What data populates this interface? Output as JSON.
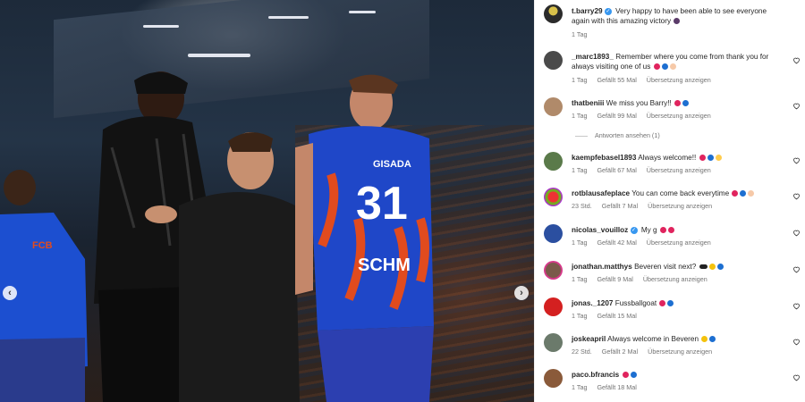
{
  "post": {
    "author": "t.barry29",
    "caption": "Very happy to have been able to see everyone again with this amazing victory",
    "time": "1 Tag"
  },
  "photo": {
    "jersey_name": "GISADA",
    "jersey_number": "31",
    "back_text": "SCHM",
    "crest_text": "FCB"
  },
  "comments": [
    {
      "user": "_marc1893_",
      "text": "Remember where you come from thank you for always visiting one of us",
      "time": "1 Tag",
      "likes": "Gefällt 55 Mal",
      "translate": "Übersetzung anzeigen"
    },
    {
      "user": "thatbeniii",
      "text": "We miss you Barry!!",
      "time": "1 Tag",
      "likes": "Gefällt 99 Mal",
      "translate": "Übersetzung anzeigen",
      "replies": "Antworten ansehen (1)"
    },
    {
      "user": "kaempfebasel1893",
      "text": "Always welcome!!",
      "time": "1 Tag",
      "likes": "Gefällt 67 Mal",
      "translate": "Übersetzung anzeigen"
    },
    {
      "user": "rotblausafeplace",
      "text": "You can come back everytime",
      "time": "23 Std.",
      "likes": "Gefällt 7 Mal",
      "translate": "Übersetzung anzeigen"
    },
    {
      "user": "nicolas_vouilloz",
      "text": "My g",
      "time": "1 Tag",
      "likes": "Gefällt 42 Mal",
      "translate": "Übersetzung anzeigen"
    },
    {
      "user": "jonathan.matthys",
      "text": "Beveren visit next?",
      "time": "1 Tag",
      "likes": "Gefällt 9 Mal",
      "translate": "Übersetzung anzeigen"
    },
    {
      "user": "jonas._1207",
      "text": "Fussballgoat",
      "time": "1 Tag",
      "likes": "Gefällt 15 Mal",
      "translate": ""
    },
    {
      "user": "joskeapril",
      "text": "Always welcome in Beveren",
      "time": "22 Std.",
      "likes": "Gefällt 2 Mal",
      "translate": "Übersetzung anzeigen"
    },
    {
      "user": "paco.bfrancis",
      "text": "",
      "time": "1 Tag",
      "likes": "Gefällt 18 Mal",
      "translate": ""
    }
  ],
  "colors": {
    "verified": "#3797f0",
    "muted_text": "#737373",
    "text": "#262626",
    "jersey_blue": "#1f47c8",
    "jersey_red": "#e14b1e"
  }
}
